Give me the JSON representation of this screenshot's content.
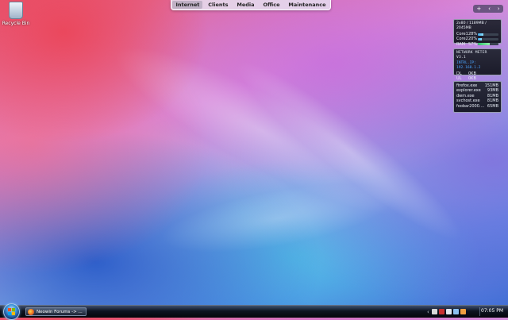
{
  "desktop": {
    "recycle_bin_label": "Recycle Bin"
  },
  "launchbar": {
    "items": [
      {
        "label": "Internet",
        "active": true
      },
      {
        "label": "Clients",
        "active": false
      },
      {
        "label": "Media",
        "active": false
      },
      {
        "label": "Office",
        "active": false
      },
      {
        "label": "Maintenance",
        "active": false
      }
    ]
  },
  "sidebar": {
    "controls": [
      "+",
      "‹",
      "›"
    ],
    "cpu_gadget": {
      "header": "2x80 / 1189MB / 2045MB",
      "rows": [
        {
          "name": "Core1",
          "value": "28%",
          "level": 0.28
        },
        {
          "name": "Core2",
          "value": "20%",
          "level": 0.2
        },
        {
          "name": "RAM",
          "value": "57%",
          "level": 0.57
        }
      ]
    },
    "network_gadget": {
      "title": "NETWORK METER V3.1",
      "ip": "INTRL.IP: 192.168.1.2",
      "rows": [
        {
          "name": "DL",
          "value": "0KB"
        },
        {
          "name": "UL",
          "value": "0KB"
        }
      ]
    },
    "process_gadget": {
      "rows": [
        {
          "name": "firefox.exe",
          "value": "151MB"
        },
        {
          "name": "explorer.exe",
          "value": "93MB"
        },
        {
          "name": "dwm.exe",
          "value": "81MB"
        },
        {
          "name": "svchost.exe",
          "value": "81MB"
        },
        {
          "name": "foobar2000....",
          "value": "65MB"
        }
      ]
    }
  },
  "taskbar": {
    "task_label": "Neowin Forums -> ...",
    "tray_chevron": "‹",
    "clock": "07:05 PM",
    "tray_icons": [
      {
        "name": "shield-icon",
        "color": "#d9d9d9"
      },
      {
        "name": "notice-icon",
        "color": "#c83030"
      },
      {
        "name": "speaker-icon",
        "color": "#e0e6ee"
      },
      {
        "name": "network-icon",
        "color": "#8cc0f0"
      },
      {
        "name": "app-icon",
        "color": "#f0a040"
      }
    ]
  }
}
